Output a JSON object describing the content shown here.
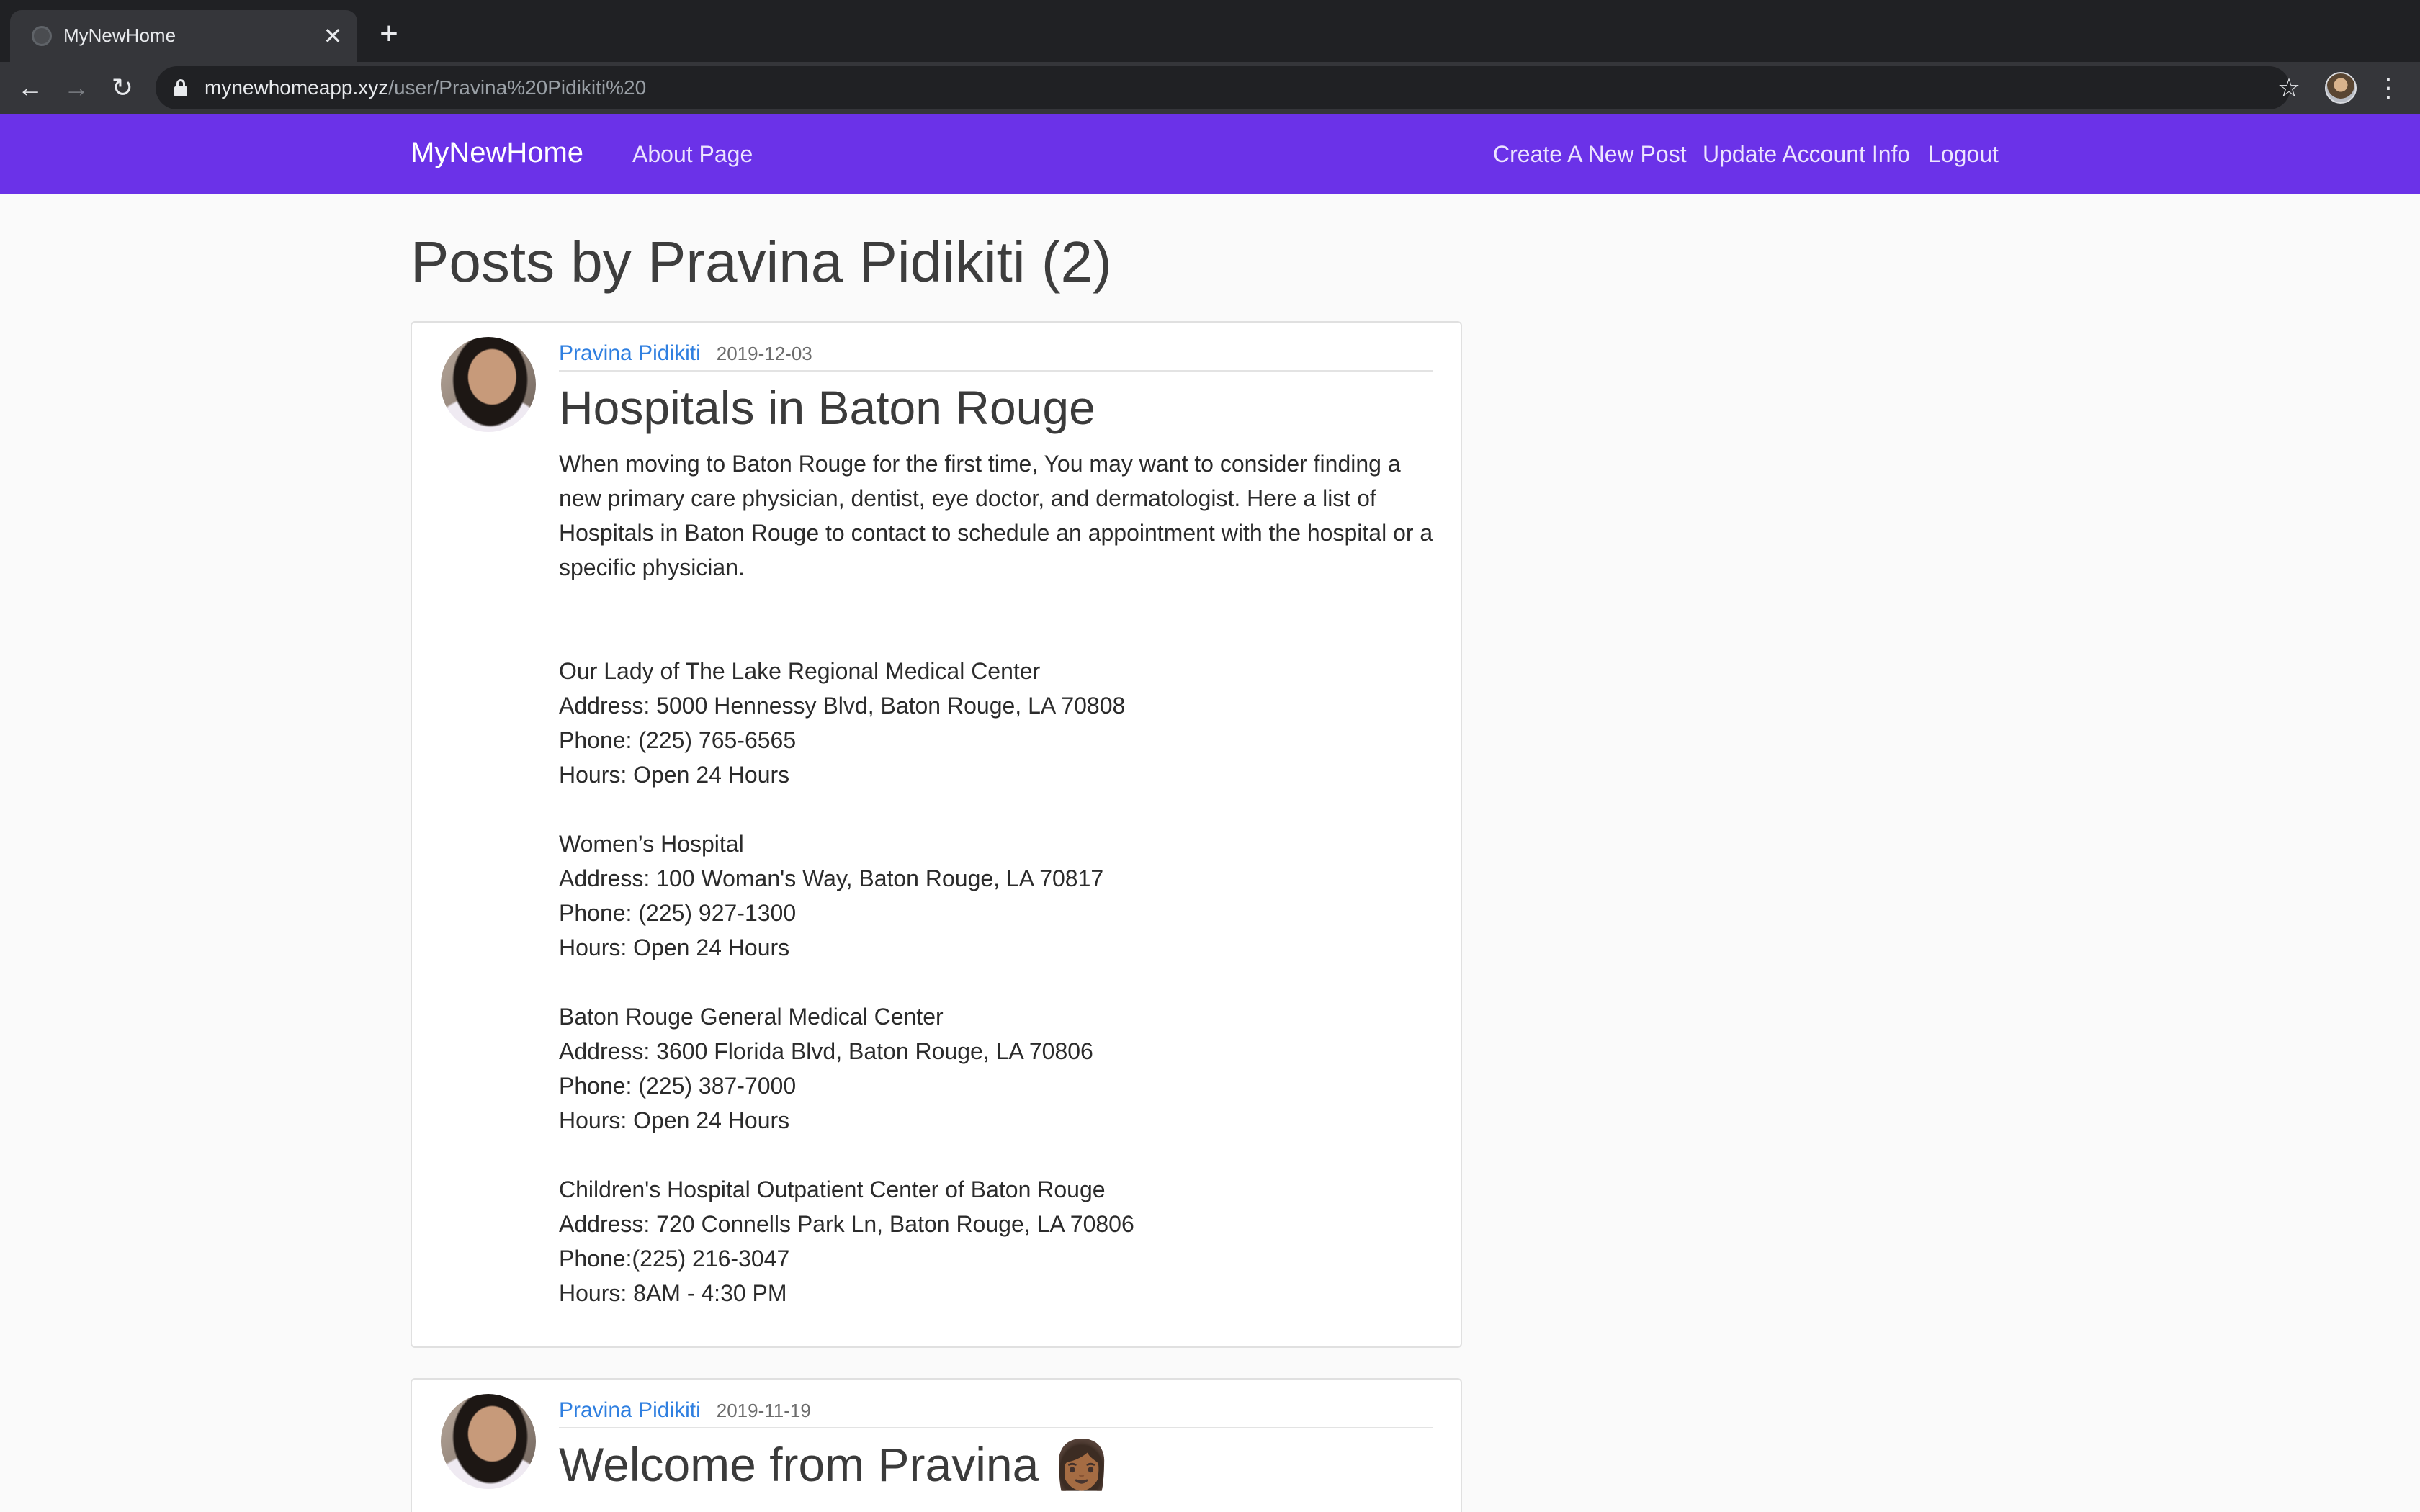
{
  "browser": {
    "tab_title": "MyNewHome",
    "tab_close": "✕",
    "new_tab": "+",
    "url_host": "mynewhomeapp.xyz",
    "url_path": "/user/Pravina%20Pidikiti%20",
    "back": "←",
    "forward": "→",
    "reload": "↻",
    "star": "☆",
    "menu": "⋮"
  },
  "navbar": {
    "brand": "MyNewHome",
    "about": "About Page",
    "create_post": "Create A New Post",
    "update_account": "Update Account Info",
    "logout": "Logout",
    "color": "#6b32e8"
  },
  "page": {
    "title": "Posts by Pravina Pidikiti (2)"
  },
  "posts": [
    {
      "author": "Pravina Pidikiti",
      "date": "2019-12-03",
      "title": "Hospitals in Baton Rouge",
      "intro": "When moving to Baton Rouge for the first time, You may want to consider finding a new primary care physician, dentist, eye doctor, and dermatologist. Here a list of Hospitals in Baton Rouge to contact to schedule an appointment with the hospital or a specific physician.",
      "hospitals": [
        {
          "name": "Our Lady of The Lake Regional Medical Center",
          "address": "Address: 5000 Hennessy Blvd, Baton Rouge, LA 70808",
          "phone": "Phone: (225) 765-6565",
          "hours": "Hours: Open 24 Hours"
        },
        {
          "name": "Women’s Hospital",
          "address": "Address: 100 Woman's Way, Baton Rouge, LA 70817",
          "phone": "Phone: (225) 927-1300",
          "hours": "Hours: Open 24 Hours"
        },
        {
          "name": "Baton Rouge General Medical Center",
          "address": "Address: 3600 Florida Blvd, Baton Rouge, LA 70806",
          "phone": "Phone: (225) 387-7000",
          "hours": "Hours: Open 24 Hours"
        },
        {
          "name": "Children's Hospital Outpatient Center of Baton Rouge",
          "address": "Address: 720 Connells Park Ln, Baton Rouge, LA 70806",
          "phone": "Phone:(225) 216-3047",
          "hours": "Hours: 8AM - 4:30 PM"
        }
      ]
    },
    {
      "author": "Pravina Pidikiti",
      "date": "2019-11-19",
      "title": "Welcome from Pravina 👩🏾"
    }
  ]
}
